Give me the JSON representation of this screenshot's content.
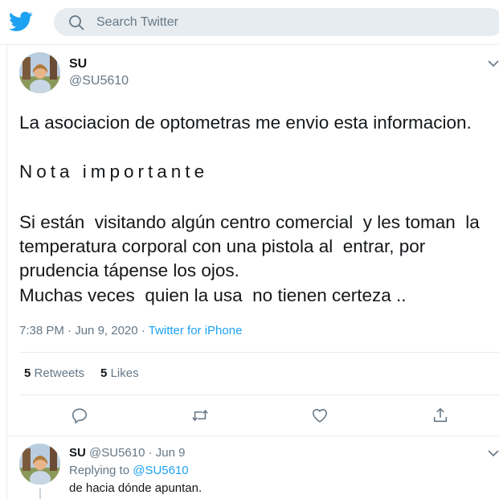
{
  "header": {
    "search_placeholder": "Search Twitter",
    "brand_color": "#1da1f2"
  },
  "tweet": {
    "author_name": "SU",
    "author_handle": "@SU5610",
    "lines": [
      "La asociacion de optometras me envio esta informacion.",
      "Nota importante",
      "Si están  visitando algún centro comercial  y les toman  la",
      "temperatura corporal con una pistola al  entrar, por",
      "prudencia tápense los ojos.",
      "Muchas veces  quien la usa  no tienen certeza .."
    ],
    "time": "7:38 PM",
    "separator": " · ",
    "date": "Jun 9, 2020",
    "source": "Twitter for iPhone",
    "retweets_count": "5",
    "retweets_label": "Retweets",
    "likes_count": "5",
    "likes_label": "Likes"
  },
  "reply": {
    "author_name": "SU",
    "author_handle": "@SU5610",
    "date": "· Jun 9",
    "replying_label": "Replying to",
    "replying_to": "@SU5610",
    "text": "de hacia dónde apuntan."
  },
  "icons": {
    "logo": "twitter-bird-icon",
    "search": "search-icon",
    "caret": "chevron-down-icon",
    "reply": "reply-icon",
    "retweet": "retweet-icon",
    "like": "heart-icon",
    "share": "share-icon"
  }
}
